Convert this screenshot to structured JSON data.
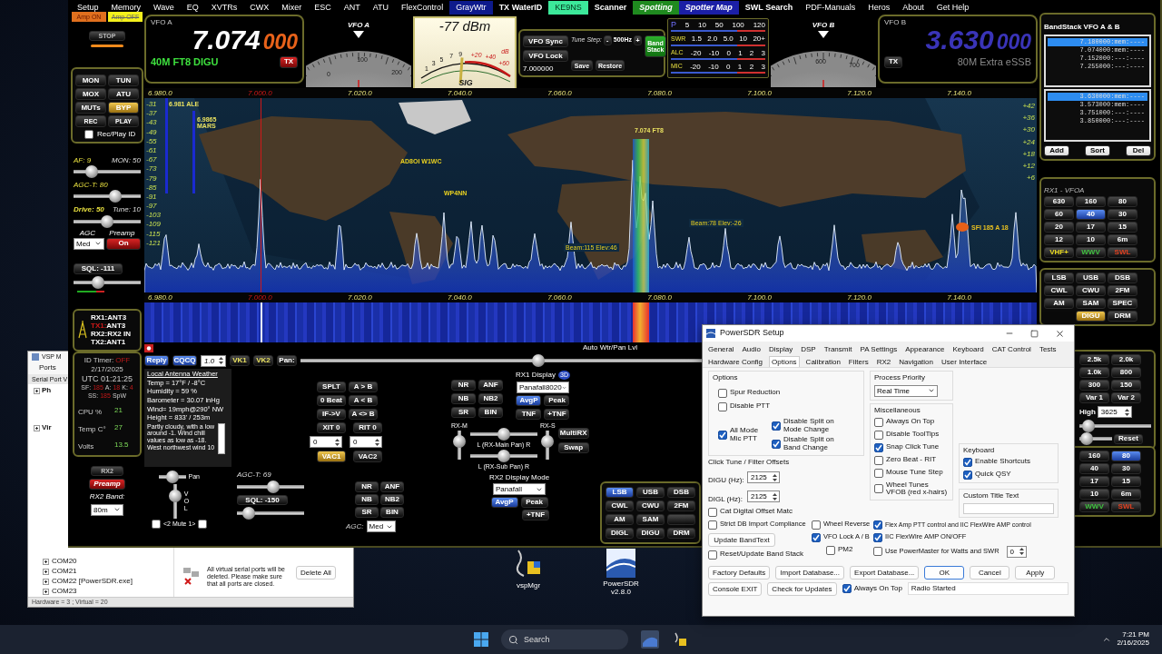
{
  "menu": [
    {
      "label": "Setup",
      "kind": "plain"
    },
    {
      "label": "Memory",
      "kind": "plain"
    },
    {
      "label": "Wave",
      "kind": "plain"
    },
    {
      "label": "EQ",
      "kind": "plain"
    },
    {
      "label": "XVTRs",
      "kind": "plain"
    },
    {
      "label": "CWX",
      "kind": "plain"
    },
    {
      "label": "Mixer",
      "kind": "plain"
    },
    {
      "label": "ESC",
      "kind": "plain"
    },
    {
      "label": "ANT",
      "kind": "plain"
    },
    {
      "label": "ATU",
      "kind": "plain"
    },
    {
      "label": "FlexControl",
      "kind": "plain"
    },
    {
      "label": "GrayWtr",
      "kind": "navy"
    },
    {
      "label": "TX WaterID",
      "kind": "bold"
    },
    {
      "label": "KE9NS",
      "kind": "mint"
    },
    {
      "label": "Scanner",
      "kind": "bold"
    },
    {
      "label": "Spotting",
      "kind": "green"
    },
    {
      "label": "Spotter Map",
      "kind": "blue"
    },
    {
      "label": "SWL Search",
      "kind": "bold"
    },
    {
      "label": "PDF-Manuals",
      "kind": "plain"
    },
    {
      "label": "Heros",
      "kind": "plain"
    },
    {
      "label": "About",
      "kind": "plain"
    },
    {
      "label": "Get Help",
      "kind": "plain"
    }
  ],
  "amp_buttons": [
    {
      "label": "Amp ON",
      "kind": "on"
    },
    {
      "label": "Amp OFF",
      "kind": "off"
    }
  ],
  "stop_button": "STOP",
  "function_buttons": [
    {
      "label": "MON",
      "selected": false
    },
    {
      "label": "TUN",
      "selected": false
    },
    {
      "label": "MOX",
      "selected": false
    },
    {
      "label": "ATU",
      "selected": false
    },
    {
      "label": "MUTs",
      "selected": false
    },
    {
      "label": "BYP",
      "selected": true
    },
    {
      "label": "REC",
      "selected": false
    },
    {
      "label": "PLAY",
      "selected": false
    }
  ],
  "rec_play_id": {
    "label": "Rec/Play ID",
    "checked": false
  },
  "rx1_sliders": [
    {
      "label": "AF: 9",
      "label_2": "MON: 50",
      "level": 0.22
    },
    {
      "label": "AGC-T: 80",
      "level": 0.65
    },
    {
      "label": "Drive: 50",
      "label_2": "Tune: 10",
      "level": 0.5
    }
  ],
  "agc": {
    "label": "AGC",
    "value": "Med"
  },
  "preamp": {
    "label": "Preamp",
    "value": "On"
  },
  "squelch": {
    "label": "SQL: -111",
    "level": 0.33
  },
  "antennas": [
    {
      "port": "RX1:",
      "antenna": "ANT3",
      "active": false
    },
    {
      "port": "TX1:",
      "antenna": "ANT3",
      "active": true
    },
    {
      "port": "RX2:",
      "antenna": "RX2 IN",
      "active": false
    },
    {
      "port": "TX2:",
      "antenna": "ANT1",
      "active": false
    }
  ],
  "status": {
    "id_timer": {
      "label": "ID Timer:",
      "value": "OFF"
    },
    "date": "2/17/2025",
    "utc": "UTC 01:21:25",
    "solar": [
      {
        "label": "SF:",
        "value": "185"
      },
      {
        "label": "A:",
        "value": "18"
      },
      {
        "label": "K:",
        "value": "4"
      }
    ],
    "ss": {
      "label": "SS:",
      "value": "185",
      "unit": "SpW"
    },
    "stats": [
      {
        "label": "CPU %",
        "value": "21"
      },
      {
        "label": "Temp C°",
        "value": "27"
      },
      {
        "label": "Volts",
        "value": "13.5"
      }
    ]
  },
  "rx2_controls": {
    "rx2_button": "RX2",
    "preamp_button": "Preamp",
    "band_label": "RX2 Band:",
    "band": "80m"
  },
  "vfo_a": {
    "label": "VFO A",
    "mhz": "7.074",
    "hz": "000",
    "mode": "40M FT8 DIGU",
    "tx": "TX"
  },
  "dial_a": {
    "label": "VFO A",
    "ticks": [
      "0",
      "100",
      "200"
    ]
  },
  "s_meter": {
    "reading": "-77 dBm",
    "scale": [
      "1",
      "3",
      "5",
      "7",
      "9"
    ],
    "scale_plus": [
      "+20",
      "+40",
      "+60"
    ],
    "unit": "dB",
    "label": "SIG"
  },
  "vfo_controls": {
    "sync": "VFO Sync",
    "lock": "VFO Lock",
    "tune_step_label": "Tune Step:",
    "minus": "-",
    "tune_step": "500Hz",
    "plus": "+",
    "memory": "7.000000",
    "save": "Save",
    "restore": "Restore",
    "band_stack": "Band Stack"
  },
  "meters": [
    {
      "label": "P",
      "scale": [
        "5",
        "10",
        "50",
        "100",
        "120"
      ]
    },
    {
      "label": "SWR",
      "scale": [
        "1.5",
        "2.0",
        "5.0",
        "10",
        "20+"
      ]
    },
    {
      "label": "ALC",
      "scale": [
        "-20",
        "-10",
        "0",
        "1",
        "2",
        "3"
      ]
    },
    {
      "label": "MIC",
      "scale": [
        "-20",
        "-10",
        "0",
        "1",
        "2",
        "3"
      ]
    }
  ],
  "dial_b": {
    "label": "VFO B",
    "ticks": [
      "600",
      "700"
    ]
  },
  "vfo_b": {
    "label": "VFO B",
    "mhz": "3.630",
    "hz": "000",
    "mode": "80M Extra eSSB",
    "tx": "TX"
  },
  "freq_axis": [
    {
      "label": "6.980.0",
      "kind": "tick"
    },
    {
      "label": "7.000.0",
      "kind": "vfo"
    },
    {
      "label": "7.020.0",
      "kind": "tick"
    },
    {
      "label": "7.040.0",
      "kind": "tick"
    },
    {
      "label": "7.060.0",
      "kind": "tick"
    },
    {
      "label": "7.080.0",
      "kind": "tick"
    },
    {
      "label": "7.100.0",
      "kind": "tick"
    },
    {
      "label": "7.120.0",
      "kind": "tick"
    },
    {
      "label": "7.140.0",
      "kind": "tick"
    }
  ],
  "db_scale": [
    "-31",
    "-37",
    "-43",
    "-49",
    "-55",
    "-61",
    "-67",
    "-73",
    "-79",
    "-85",
    "-91",
    "-97",
    "-103",
    "-109",
    "-115",
    "-121"
  ],
  "s_scale": [
    "+42",
    "+36",
    "+30",
    "+24",
    "+18",
    "+12",
    "+6"
  ],
  "spots": [
    {
      "text": "6.981 ALE",
      "kind": "band"
    },
    {
      "text": "6.9865 MARS",
      "kind": "band"
    },
    {
      "text": "7.074 FT8",
      "kind": "band"
    },
    {
      "text": "AD8OI W1WC",
      "kind": "call"
    },
    {
      "text": "WP4NN",
      "kind": "call"
    },
    {
      "text": "Beam:78 Elev:-26",
      "kind": "beam"
    },
    {
      "text": "Beam:115 Elev:46",
      "kind": "beam"
    },
    {
      "text": "SFI 185 A 18",
      "kind": "sun"
    }
  ],
  "waterfall_axis": [
    {
      "label": "6.980.0",
      "kind": "tick"
    },
    {
      "label": "7.000.0",
      "kind": "vfo"
    },
    {
      "label": "7.020.0",
      "kind": "tick"
    },
    {
      "label": "7.040.0",
      "kind": "tick"
    },
    {
      "label": "7.060.0",
      "kind": "tick"
    },
    {
      "label": "7.080.0",
      "kind": "tick"
    },
    {
      "label": "7.100.0",
      "kind": "tick"
    },
    {
      "label": "7.120.0",
      "kind": "tick"
    },
    {
      "label": "7.140.0",
      "kind": "tick"
    }
  ],
  "auto_level_label": "Auto Wtr/Pan Lvl",
  "cw_buttons": [
    {
      "label": "Reply",
      "kind": "blue"
    },
    {
      "label": "CQCQ",
      "kind": "blue"
    }
  ],
  "cw_speed": "1.0",
  "voice_buttons": [
    "VK1",
    "VK2"
  ],
  "pan": {
    "label": "Pan:",
    "level": 0.32
  },
  "weather": {
    "title": "Local Antenna Weather",
    "lines": [
      "Temp = 17°F / -8°C",
      "Humidity = 59 %",
      "Barometer = 30.07 inHg",
      "Wind= 19mph@290° NW",
      "Height = 833' / 253m"
    ],
    "forecast": "Partly cloudy, with a low around -1. Wind chill values as low as -18. West northwest wind 10"
  },
  "vfo_buttons": [
    "SPLT",
    "A > B",
    "0 Beat",
    "A < B",
    "IF->V",
    "A <> B"
  ],
  "xit": {
    "label": "XIT",
    "value": "0",
    "entry": "0"
  },
  "rit": {
    "label": "RIT",
    "value": "0",
    "entry": "0"
  },
  "vac_buttons": [
    {
      "label": "VAC1",
      "selected": true
    },
    {
      "label": "VAC2",
      "selected": false
    }
  ],
  "rx1_dsp": [
    "NR",
    "ANF",
    "NB",
    "NB2",
    "SR",
    "BIN"
  ],
  "rx1_display": {
    "label": "RX1 Display",
    "badge": "3D",
    "mode": "Panafall8020",
    "buttons": [
      {
        "label": "AvgP",
        "selected": true
      },
      {
        "label": "Peak",
        "selected": false
      },
      {
        "label": "TNF",
        "selected": false
      },
      {
        "label": "+TNF",
        "selected": false
      }
    ]
  },
  "rx_mix": {
    "main": {
      "label": "RX-M",
      "level": 0.75
    },
    "sub": {
      "label": "RX-S",
      "level": 0.75
    },
    "main_pan": {
      "label": "L (RX-Main Pan) R",
      "level": 0.5
    },
    "sub_pan": {
      "label": "L (RX-Sub Pan) R",
      "level": 0.5
    }
  },
  "multirx_buttons": [
    "MultiRX",
    "Swap"
  ],
  "rx2_audio": {
    "pan": {
      "label": "Pan",
      "level": 0.45
    },
    "volume": {
      "label": "VOL",
      "level": 0.75
    },
    "mute": {
      "label": "<2 Mute 1>",
      "mute_2": false,
      "mute_1": false
    }
  },
  "rx2_agc_t": {
    "label": "AGC-T: 69",
    "level": 0.55
  },
  "rx2_sql": {
    "label": "SQL: -150",
    "level": 0.1
  },
  "rx2_dsp": [
    "NR",
    "ANF",
    "NB",
    "NB2",
    "SR",
    "BIN"
  ],
  "rx2_agc": {
    "label": "AGC:",
    "value": "Med"
  },
  "rx2_display": {
    "label": "RX2 Display Mode",
    "mode": "Panafall",
    "buttons": [
      {
        "label": "AvgP",
        "selected": true
      },
      {
        "label": "Peak",
        "selected": false
      },
      {
        "label": "+TNF",
        "selected": false
      }
    ]
  },
  "rx2_modes": [
    [
      {
        "label": "LSB",
        "selected": true
      },
      {
        "label": "USB",
        "selected": false
      },
      {
        "label": "DSB",
        "selected": false
      }
    ],
    [
      {
        "label": "CWL",
        "selected": false
      },
      {
        "label": "CWU",
        "selected": false
      },
      {
        "label": "2FM",
        "selected": false
      }
    ],
    [
      {
        "label": "AM",
        "selected": false
      },
      {
        "label": "SAM",
        "selected": false
      }
    ],
    [
      {
        "label": "DIGL",
        "selected": false
      },
      {
        "label": "DIGU",
        "selected": false
      },
      {
        "label": "DRM",
        "selected": false
      }
    ]
  ],
  "bandstack": {
    "title": "BandStack VFO A & B",
    "vfo_a": [
      {
        "entry": "7.180000:mem:----",
        "selected": true
      },
      {
        "entry": "7.074000:mem:----",
        "selected": false
      },
      {
        "entry": "7.152000:---:----",
        "selected": false
      },
      {
        "entry": "7.255000:---:----",
        "selected": false
      }
    ],
    "vfo_b": [
      {
        "entry": "3.630000:mem:----",
        "selected": true
      },
      {
        "entry": "3.573000:mem:----",
        "selected": false
      },
      {
        "entry": "3.751000:---:----",
        "selected": false
      },
      {
        "entry": "3.850000:---:----",
        "selected": false
      }
    ],
    "buttons": [
      "Add",
      "Sort",
      "Del"
    ]
  },
  "rx1_bands": {
    "title": "RX1 - VFOA",
    "bands": [
      {
        "label": "630",
        "selected": false,
        "kind": "band"
      },
      {
        "label": "160",
        "selected": false,
        "kind": "band"
      },
      {
        "label": "80",
        "selected": false,
        "kind": "band"
      },
      {
        "label": "60",
        "selected": false,
        "kind": "band"
      },
      {
        "label": "40",
        "selected": true,
        "kind": "band"
      },
      {
        "label": "30",
        "selected": false,
        "kind": "band"
      },
      {
        "label": "20",
        "selected": false,
        "kind": "band"
      },
      {
        "label": "17",
        "selected": false,
        "kind": "band"
      },
      {
        "label": "15",
        "selected": false,
        "kind": "band"
      },
      {
        "label": "12",
        "selected": false,
        "kind": "band"
      },
      {
        "label": "10",
        "selected": false,
        "kind": "band"
      },
      {
        "label": "6m",
        "selected": false,
        "kind": "band"
      },
      {
        "label": "VHF+",
        "selected": false,
        "kind": "vhf"
      },
      {
        "label": "WWV",
        "selected": false,
        "kind": "wwv"
      },
      {
        "label": "SWL",
        "selected": false,
        "kind": "swl"
      }
    ]
  },
  "rx1_modes": [
    {
      "label": "LSB",
      "selected": false
    },
    {
      "label": "USB",
      "selected": false
    },
    {
      "label": "DSB",
      "selected": false
    },
    {
      "label": "CWL",
      "selected": false
    },
    {
      "label": "CWU",
      "selected": false
    },
    {
      "label": "2FM",
      "selected": false
    },
    {
      "label": "AM",
      "selected": false
    },
    {
      "label": "SAM",
      "selected": false
    },
    {
      "label": "SPEC",
      "selected": false
    },
    {
      "label": "DIGU",
      "selected": true
    },
    {
      "label": "DRM",
      "selected": false
    }
  ],
  "filters": {
    "buttons": [
      "2.5k",
      "2.0k",
      "1.0k",
      "800",
      "300",
      "150",
      "Var 1",
      "Var 2"
    ],
    "high_label": "High",
    "high_value": "3625",
    "reset": "Reset",
    "shift": {
      "level": 0.05
    },
    "width": {
      "level": 0.05
    }
  },
  "rx2_bands": [
    {
      "label": "160",
      "selected": false,
      "kind": "band"
    },
    {
      "label": "80",
      "selected": true,
      "kind": "band"
    },
    {
      "label": "40",
      "selected": false,
      "kind": "band"
    },
    {
      "label": "30",
      "selected": false,
      "kind": "band"
    },
    {
      "label": "17",
      "selected": false,
      "kind": "band"
    },
    {
      "label": "15",
      "selected": false,
      "kind": "band"
    },
    {
      "label": "10",
      "selected": false,
      "kind": "band"
    },
    {
      "label": "6m",
      "selected": false,
      "kind": "band"
    },
    {
      "label": "WWV",
      "selected": false,
      "kind": "wwv"
    },
    {
      "label": "SWL",
      "selected": false,
      "kind": "swl"
    }
  ],
  "vsp": {
    "title": "VSP M",
    "menu": "Ports",
    "tab": "Serial Port V",
    "tree_top": [
      "Ph",
      "Vir"
    ],
    "ports": [
      "COM20",
      "COM21",
      "COM22 [PowerSDR.exe]",
      "COM23"
    ],
    "info": "All virtual serial ports will be deleted. Please make sure that all ports are closed.",
    "delete": "Delete All",
    "status": "Hardware = 3 ; Virtual = 20"
  },
  "desktop_icons": [
    {
      "label": "vspMgr",
      "kind": "vsp"
    },
    {
      "label": "PowerSDR v2.8.0",
      "kind": "sdr"
    }
  ],
  "setup": {
    "title": "PowerSDR Setup",
    "tabs_row_1": [
      {
        "label": "General",
        "selected": false
      },
      {
        "label": "Audio",
        "selected": false
      },
      {
        "label": "Display",
        "selected": false
      },
      {
        "label": "DSP",
        "selected": false
      },
      {
        "label": "Transmit",
        "selected": false
      },
      {
        "label": "PA Settings",
        "selected": false
      },
      {
        "label": "Appearance",
        "selected": false
      },
      {
        "label": "Keyboard",
        "selected": false
      },
      {
        "label": "CAT Control",
        "selected": false
      },
      {
        "label": "Tests",
        "selected": false
      }
    ],
    "tabs_row_2": [
      {
        "label": "Hardware Config",
        "selected": false
      },
      {
        "label": "Options",
        "selected": true
      },
      {
        "label": "Calibration",
        "selected": false
      },
      {
        "label": "Filters",
        "selected": false
      },
      {
        "label": "RX2",
        "selected": false
      },
      {
        "label": "Navigation",
        "selected": false
      },
      {
        "label": "User Interface",
        "selected": false
      }
    ],
    "options": {
      "title": "Options",
      "checks": [
        {
          "label": "Spur Reduction",
          "checked": false
        },
        {
          "label": "Disable PTT",
          "checked": false
        }
      ],
      "mic_ptt": {
        "label": "All Mode Mic PTT",
        "checked": true
      },
      "split_checks": [
        {
          "label": "Disable Split on Mode Change",
          "checked": true
        },
        {
          "label": "Disable Split on Band Change",
          "checked": true
        }
      ]
    },
    "offsets": {
      "title": "Click Tune / Filter Offsets",
      "fields": [
        {
          "label": "DIGU (Hz):",
          "value": "2125"
        },
        {
          "label": "DIGL (Hz):",
          "value": "2125"
        }
      ],
      "cat_offset": {
        "label": "Cat Digital Offset Matc",
        "checked": false
      }
    },
    "process_priority": {
      "title": "Process Priority",
      "value": "Real Time"
    },
    "misc": {
      "title": "Miscellaneous",
      "checks": [
        {
          "label": "Always On Top",
          "checked": false
        },
        {
          "label": "Disable ToolTips",
          "checked": false
        },
        {
          "label": "Snap Click Tune",
          "checked": true
        },
        {
          "label": "Zero Beat -  RIT",
          "checked": false
        },
        {
          "label": "Mouse Tune Step",
          "checked": false
        },
        {
          "label": "Wheel Tunes VFOB (red x-hairs)",
          "checked": false
        }
      ]
    },
    "keyboard": {
      "title": "Keyboard",
      "checks": [
        {
          "label": "Enable Shortcuts",
          "checked": true
        },
        {
          "label": "Quick QSY",
          "checked": true
        }
      ]
    },
    "custom_title": "Custom Title Text",
    "strict_db": {
      "label": "Strict DB Import Compliance",
      "checked": false
    },
    "update_bandtext": "Update BandText",
    "reset_band_stack": {
      "label": "Reset/Update Band Stack",
      "checked": false
    },
    "wheel_reverse": {
      "label": "Wheel Reverse",
      "checked": false
    },
    "vfo_lock": {
      "label": "VFO Lock A / B",
      "checked": true
    },
    "flex_amp_ptt": {
      "label": "Flex Amp PTT control and IIC FlexWire AMP control",
      "checked": true
    },
    "iic_amp": {
      "label": "IIC FlexWire AMP ON/OFF",
      "checked": true
    },
    "pm2": {
      "label": "PM2",
      "checked": false
    },
    "powermaster": {
      "label": "Use PowerMaster for Watts and SWR",
      "checked": false
    },
    "powermaster_value": "0",
    "buttons_row_1": [
      {
        "label": "Factory Defaults",
        "kind": "plain"
      },
      {
        "label": "Import Database...",
        "kind": "plain"
      },
      {
        "label": "Export Database...",
        "kind": "plain"
      },
      {
        "label": "OK",
        "kind": "default"
      },
      {
        "label": "Cancel",
        "kind": "plain"
      },
      {
        "label": "Apply",
        "kind": "plain"
      }
    ],
    "buttons_row_2": [
      "Console EXIT",
      "Check for Updates"
    ],
    "always_on_top": {
      "label": "Always On Top",
      "checked": true
    },
    "status": "Radio Started"
  },
  "taskbar": {
    "search": "Search",
    "time": "7:21 PM",
    "date": "2/16/2025"
  }
}
